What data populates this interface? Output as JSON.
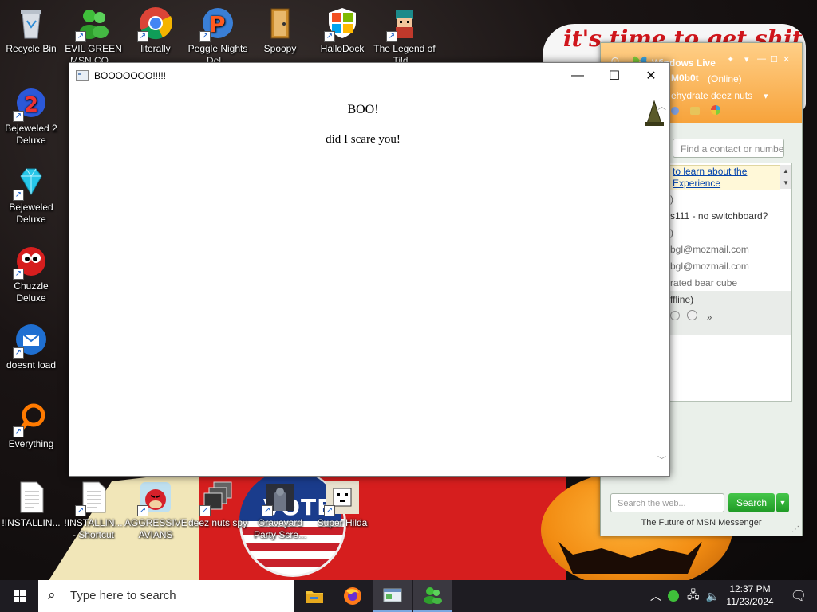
{
  "desktop": {
    "icons": [
      {
        "label": "Recycle Bin",
        "icon": "recycle-bin-icon"
      },
      {
        "label": "EVIL GREEN MSN CO...",
        "icon": "msn-buddies-icon"
      },
      {
        "label": "literally",
        "icon": "chrome-icon"
      },
      {
        "label": "Peggle Nights Del...",
        "icon": "peggle-icon"
      },
      {
        "label": "Spoopy",
        "icon": "door-icon"
      },
      {
        "label": "HalloDock",
        "icon": "windows-shield-icon"
      },
      {
        "label": "The Legend of Tild...",
        "icon": "game-character-icon"
      },
      {
        "label": "Bejeweled 2 Deluxe",
        "icon": "bejeweled2-icon"
      },
      {
        "label": "Bejeweled Deluxe",
        "icon": "diamond-icon"
      },
      {
        "label": "Chuzzle Deluxe",
        "icon": "chuzzle-icon"
      },
      {
        "label": "doesnt load",
        "icon": "thunderbird-icon"
      },
      {
        "label": "Everything",
        "icon": "magnifier-icon"
      },
      {
        "label": "!INSTALLIN...",
        "icon": "text-file-icon"
      },
      {
        "label": "!INSTALLIN... - Shortcut",
        "icon": "text-file-icon"
      },
      {
        "label": "AGGRESSIVE AVIANS",
        "icon": "angry-bird-icon"
      },
      {
        "label": "deez nuts spy",
        "icon": "windows-stack-icon"
      },
      {
        "label": "Graveyard Party Scre...",
        "icon": "graveyard-icon"
      },
      {
        "label": "Super Hilda",
        "icon": "pixel-dog-icon"
      }
    ],
    "wallpaper_text": "it's time to get shit",
    "badge_text": "VOTE"
  },
  "dialog": {
    "title": "BOOOOOOO!!!!!",
    "heading": "BOO!",
    "message": "did I scare you!",
    "min_glyph": "—",
    "max_glyph": "☐",
    "close_glyph": "✕"
  },
  "messenger": {
    "title": "Windows Live",
    "username": "M0b0t",
    "status": "(Online)",
    "personal_message": "ehydrate deez nuts",
    "find_placeholder": "Find a contact or numbe",
    "banner_line1": "to learn about the",
    "banner_line2": "Experience",
    "contacts": [
      {
        "text": ")",
        "style": "gray"
      },
      {
        "text": "s111 - no switchboard?",
        "style": "dark"
      },
      {
        "text": ")",
        "style": "gray"
      },
      {
        "text": "bgl@mozmail.com",
        "style": "gray"
      },
      {
        "text": "bgl@mozmail.com",
        "style": "gray"
      },
      {
        "text": "rated bear cube",
        "style": "gray"
      },
      {
        "text": "ffline)",
        "style": "dark"
      }
    ],
    "more_glyph": "»",
    "search_placeholder": "Search the web...",
    "search_button": "Search",
    "footer": "The Future of MSN Messenger"
  },
  "taskbar": {
    "search_placeholder": "Type here to search",
    "apps": [
      "file-explorer-icon",
      "firefox-icon",
      "window-app-icon",
      "msn-messenger-icon"
    ],
    "time": "12:37 PM",
    "date": "11/23/2024"
  }
}
